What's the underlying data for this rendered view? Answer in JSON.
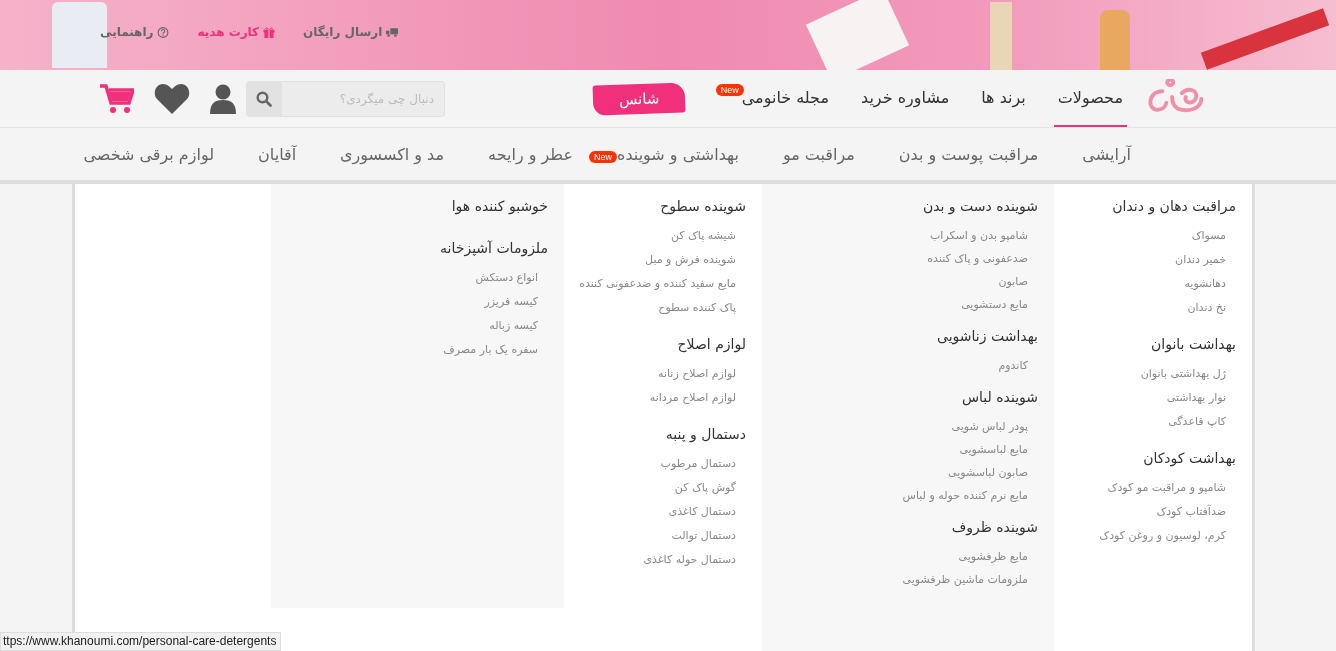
{
  "top_links": [
    {
      "label": "ارسال رایگان",
      "kind": "truck",
      "highlighted": false
    },
    {
      "label": "کارت هدیه",
      "kind": "gift",
      "highlighted": true
    },
    {
      "label": "راهنمایی",
      "kind": "help",
      "highlighted": false
    }
  ],
  "nav": [
    {
      "label": "محصولات",
      "selected": true
    },
    {
      "label": "برند ها",
      "selected": false
    },
    {
      "label": "مشاوره خرید",
      "selected": false
    },
    {
      "label": "مجله خانومی",
      "selected": false,
      "badge": "New"
    }
  ],
  "chance_link": "شانس",
  "search": {
    "placeholder": "دنبال چی میگردی؟"
  },
  "categories": [
    {
      "label": "آرایشی"
    },
    {
      "label": "مراقبت پوست و بدن"
    },
    {
      "label": "مراقبت مو"
    },
    {
      "label": "بهداشتی و شوینده",
      "badge": "New"
    },
    {
      "label": "عطر و رایحه"
    },
    {
      "label": "مد و اکسسوری"
    },
    {
      "label": "آقایان"
    },
    {
      "label": "لوازم برقی شخصی"
    }
  ],
  "mega_menu": {
    "columns": [
      {
        "groups": [
          {
            "title": "مراقبت دهان و دندان",
            "items": [
              "مسواک",
              "خمیر دندان",
              "دهانشویه",
              "نخ دندان"
            ]
          },
          {
            "title": "بهداشت بانوان",
            "items": [
              "ژل بهداشتی بانوان",
              "نوار بهداشتی",
              "کاپ قاعدگی"
            ]
          },
          {
            "title": "بهداشت کودکان",
            "items": [
              "شامپو و مراقبت مو کودک",
              "ضدآفتاب کودک",
              "کرم، لوسیون و روغن کودک"
            ]
          }
        ]
      },
      {
        "groups": [
          {
            "title": "شوینده دست و بدن",
            "items": [
              "شامپو بدن و اسکراب",
              "ضدعفونی و پاک کننده",
              "صابون",
              "مایع دستشویی"
            ]
          },
          {
            "title": "بهداشت زناشویی",
            "items": [
              "کاندوم"
            ]
          },
          {
            "title": "شوینده لباس",
            "items": [
              "پودر لباس شویی",
              "مایع لباسشویی",
              "صابون لباسشویی",
              "مایع نرم کننده حوله و لباس"
            ]
          },
          {
            "title": "شوینده ظروف",
            "items": [
              "مایع ظرفشویی",
              "ملزومات ماشین ظرفشویی"
            ]
          }
        ]
      },
      {
        "groups": [
          {
            "title": "شوینده سطوح",
            "items": [
              "شیشه پاک کن",
              "شوینده فرش و مبل",
              "مایع سفید کننده و ضدعفونی کننده",
              "پاک کننده سطوح"
            ]
          },
          {
            "title": "لوازم اصلاح",
            "items": [
              "لوازم اصلاح زنانه",
              "لوازم اصلاح مردانه"
            ]
          },
          {
            "title": "دستمال و پنبه",
            "items": [
              "دستمال مرطوب",
              "گوش پاک کن",
              "دستمال کاغذی",
              "دستمال توالت",
              "دستمال حوله کاغذی"
            ]
          }
        ]
      },
      {
        "groups": [
          {
            "title": "خوشبو کننده هوا"
          },
          {
            "title": "ملزومات آشپزخانه",
            "items": [
              "انواع دستکش",
              "کیسه فریزر",
              "کیسه زباله",
              "سفره یک بار مصرف"
            ]
          }
        ]
      }
    ]
  },
  "status_url": "ttps://www.khanoumi.com/personal-care-detergents"
}
